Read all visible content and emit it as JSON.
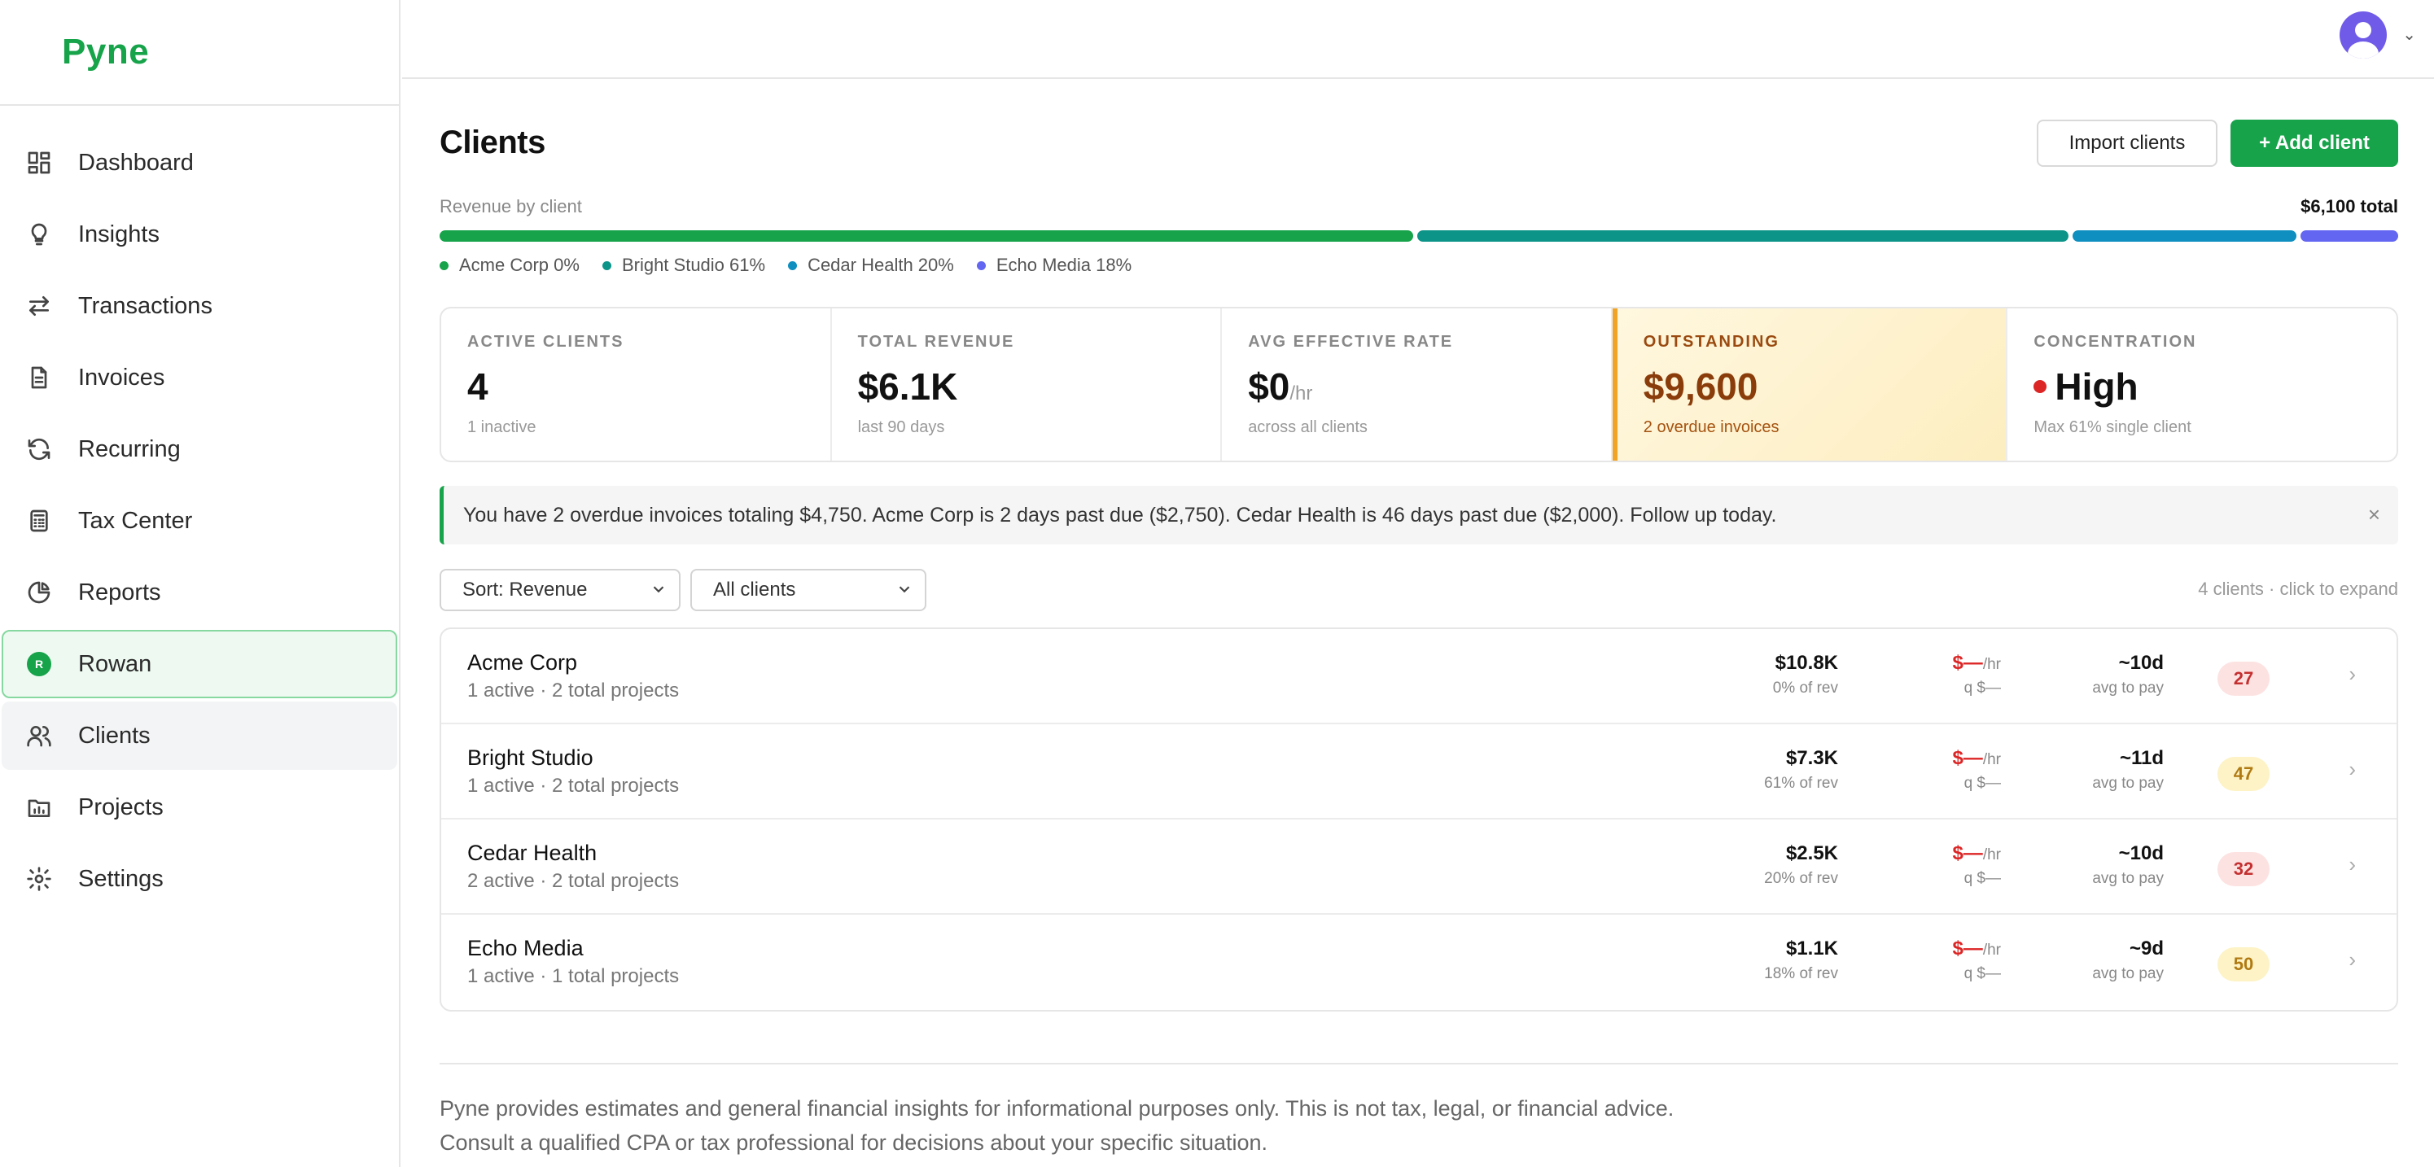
{
  "app": {
    "name": "Pyne"
  },
  "sidebar": {
    "items": [
      {
        "label": "Dashboard",
        "icon": "dashboard-icon"
      },
      {
        "label": "Insights",
        "icon": "lightbulb-icon"
      },
      {
        "label": "Transactions",
        "icon": "arrows-swap-icon"
      },
      {
        "label": "Invoices",
        "icon": "document-icon"
      },
      {
        "label": "Recurring",
        "icon": "refresh-icon"
      },
      {
        "label": "Tax Center",
        "icon": "calculator-icon"
      },
      {
        "label": "Reports",
        "icon": "pie-chart-icon"
      },
      {
        "label": "Rowan",
        "icon": "rowan-badge",
        "badge": "R"
      },
      {
        "label": "Clients",
        "icon": "users-icon",
        "active": true
      },
      {
        "label": "Projects",
        "icon": "folder-chart-icon"
      },
      {
        "label": "Settings",
        "icon": "gear-icon"
      }
    ]
  },
  "header": {
    "title": "Clients",
    "import_label": "Import clients",
    "add_label": "+ Add client"
  },
  "revenue": {
    "label": "Revenue by client",
    "total": "$6,100 total",
    "segments": [
      {
        "label": "Acme Corp 0%",
        "color": "#16a34a",
        "share": 0.5
      },
      {
        "label": "Bright Studio 61%",
        "color": "#0d9488",
        "share": 0.335
      },
      {
        "label": "Cedar Health 20%",
        "color": "#0e8fc0",
        "share": 0.115
      },
      {
        "label": "Echo Media 18%",
        "color": "#6366f1",
        "share": 0.05
      }
    ]
  },
  "stats": {
    "active": {
      "key": "ACTIVE CLIENTS",
      "value": "4",
      "sub": "1 inactive"
    },
    "revenue": {
      "key": "TOTAL REVENUE",
      "value": "$6.1K",
      "sub": "last 90 days"
    },
    "rate": {
      "key": "AVG EFFECTIVE RATE",
      "value": "$0",
      "unit": "/hr",
      "sub": "across all clients"
    },
    "outstanding": {
      "key": "OUTSTANDING",
      "value": "$9,600",
      "sub": "2 overdue invoices"
    },
    "concentration": {
      "key": "CONCENTRATION",
      "value": "High",
      "sub": "Max 61% single client"
    }
  },
  "alert": {
    "text": "You have 2 overdue invoices totaling $4,750. Acme Corp is 2 days past due ($2,750). Cedar Health is 46 days past due ($2,000). Follow up today.",
    "close": "×"
  },
  "filters": {
    "sort": "Sort: Revenue",
    "scope": "All clients",
    "hint": "4 clients · click to expand"
  },
  "clients": [
    {
      "name": "Acme Corp",
      "sub": "1 active · 2 total projects",
      "rev": "$10.8K",
      "rev_share": "0% of rev",
      "rate": "$—",
      "rate_unit": "/hr",
      "rate_q": "q $—",
      "pay": "~10d",
      "pay_label": "avg to pay",
      "score": "27",
      "score_tone": "red"
    },
    {
      "name": "Bright Studio",
      "sub": "1 active · 2 total projects",
      "rev": "$7.3K",
      "rev_share": "61% of rev",
      "rate": "$—",
      "rate_unit": "/hr",
      "rate_q": "q $—",
      "pay": "~11d",
      "pay_label": "avg to pay",
      "score": "47",
      "score_tone": "amber"
    },
    {
      "name": "Cedar Health",
      "sub": "2 active · 2 total projects",
      "rev": "$2.5K",
      "rev_share": "20% of rev",
      "rate": "$—",
      "rate_unit": "/hr",
      "rate_q": "q $—",
      "pay": "~10d",
      "pay_label": "avg to pay",
      "score": "32",
      "score_tone": "red"
    },
    {
      "name": "Echo Media",
      "sub": "1 active · 1 total projects",
      "rev": "$1.1K",
      "rev_share": "18% of rev",
      "rate": "$—",
      "rate_unit": "/hr",
      "rate_q": "q $—",
      "pay": "~9d",
      "pay_label": "avg to pay",
      "score": "50",
      "score_tone": "amber"
    }
  ],
  "footer": {
    "disclaimer": "Pyne provides estimates and general financial insights for informational purposes only. This is not tax, legal, or financial advice. Consult a qualified CPA or tax professional for decisions about your specific situation."
  }
}
